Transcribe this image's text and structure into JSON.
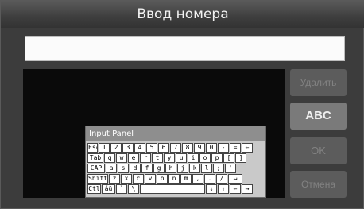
{
  "window": {
    "title": "Ввод номера"
  },
  "input": {
    "value": ""
  },
  "buttons": {
    "delete": "Удалить",
    "abc": "ABC",
    "ok": "OK",
    "cancel": "Отмена"
  },
  "keyboard": {
    "title": "Input Panel",
    "rows": [
      [
        "Esc",
        "1",
        "2",
        "3",
        "4",
        "5",
        "6",
        "7",
        "8",
        "9",
        "0",
        "-",
        "=",
        "←"
      ],
      [
        "Tab",
        "q",
        "w",
        "e",
        "r",
        "t",
        "y",
        "u",
        "i",
        "o",
        "p",
        "[",
        "]"
      ],
      [
        "CAP",
        "a",
        "s",
        "d",
        "f",
        "g",
        "h",
        "j",
        "k",
        "l",
        ";",
        "'"
      ],
      [
        "Shift",
        "z",
        "x",
        "c",
        "v",
        "b",
        "n",
        "m",
        ",",
        ".",
        "/",
        "↵"
      ],
      [
        "Ctl",
        "áü",
        "`",
        "\\",
        " ",
        "↓",
        "↑",
        "←",
        "→"
      ]
    ]
  }
}
